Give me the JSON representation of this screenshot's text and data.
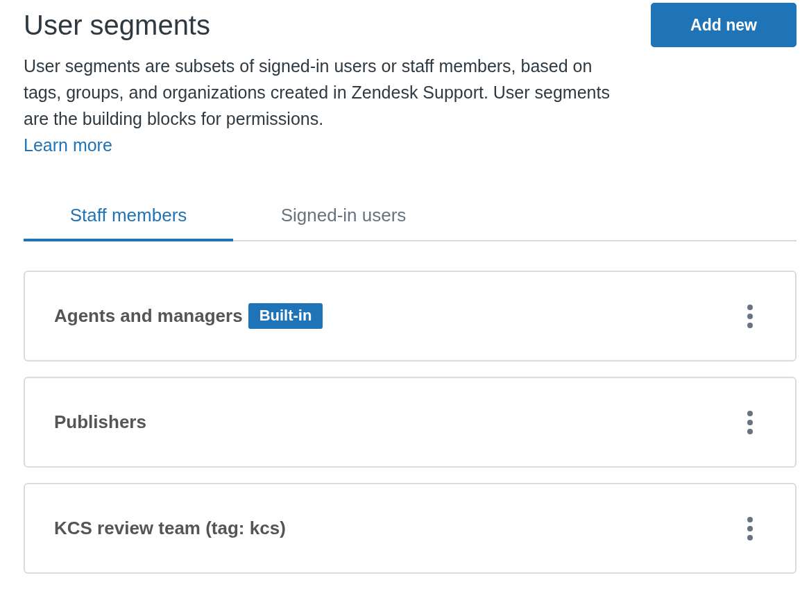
{
  "header": {
    "title": "User segments",
    "add_button": "Add new"
  },
  "description": {
    "text": "User segments are subsets of signed-in users or staff members, based on tags, groups, and organizations created in Zendesk Support. User segments are the building blocks for permissions.",
    "link": "Learn more"
  },
  "tabs": [
    {
      "label": "Staff members",
      "selected": true
    },
    {
      "label": "Signed-in users",
      "selected": false
    }
  ],
  "segments": [
    {
      "name": "Agents and managers",
      "badge": "Built-in"
    },
    {
      "name": "Publishers"
    },
    {
      "name": "KCS review team (tag: kcs)"
    }
  ]
}
